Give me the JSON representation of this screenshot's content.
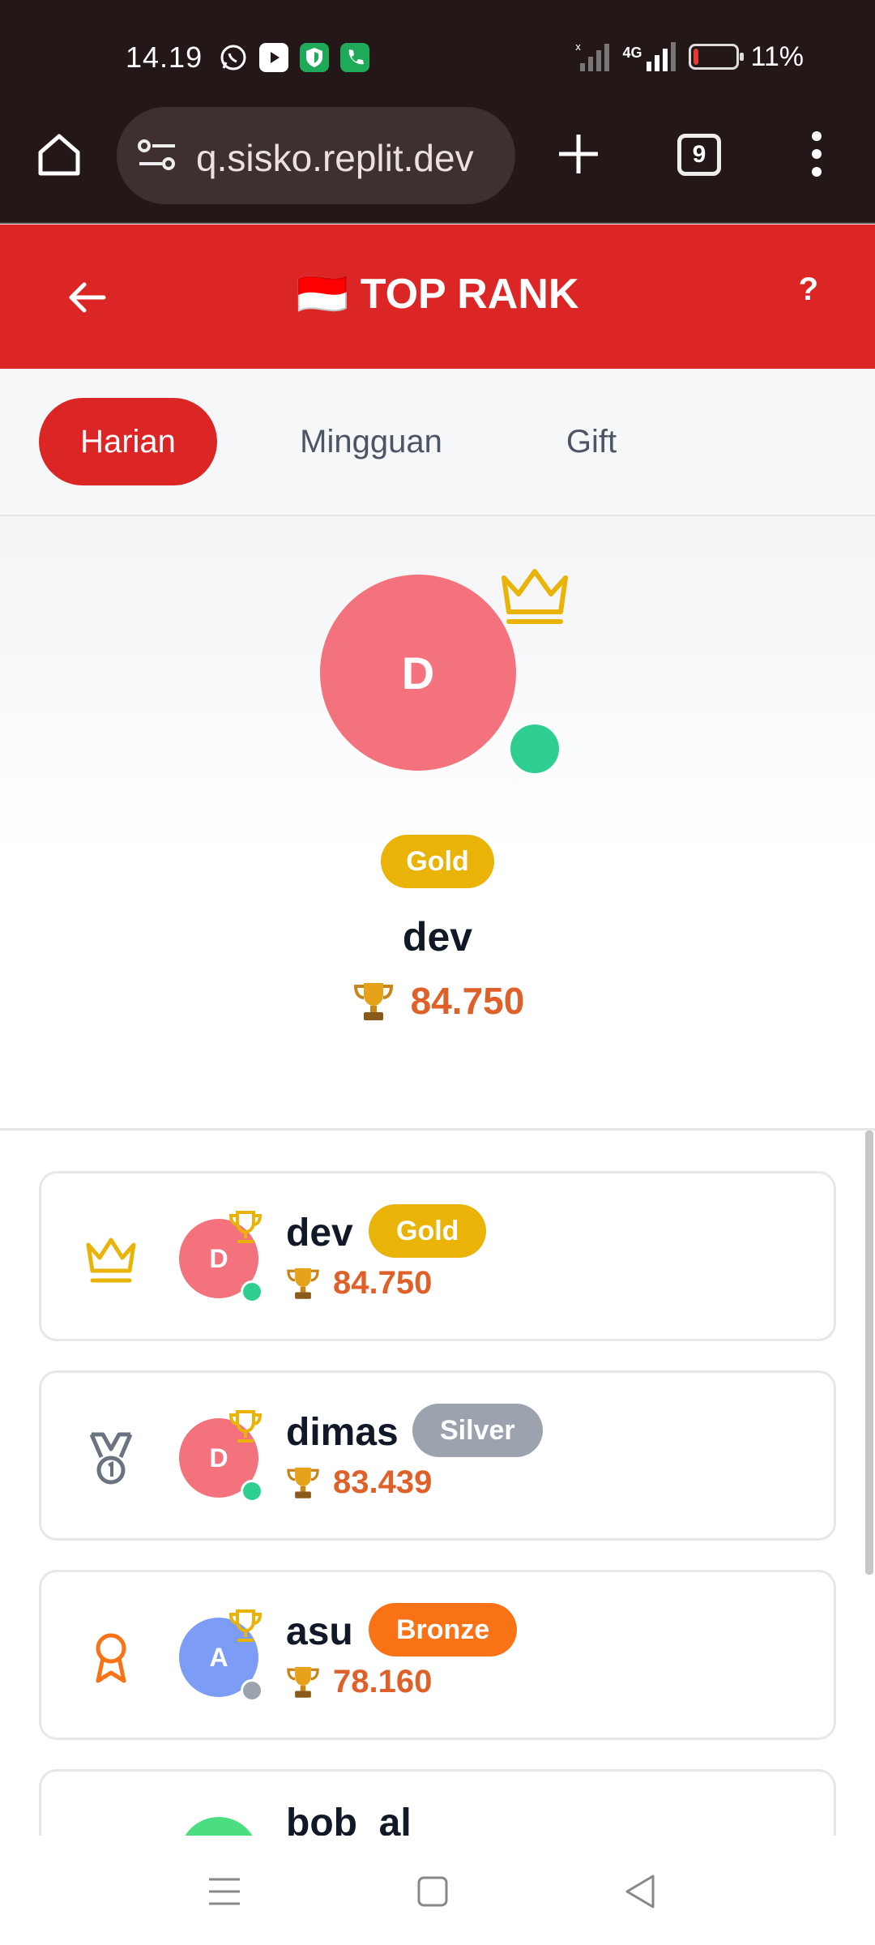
{
  "status_bar": {
    "time": "14.19",
    "apps": [
      "whatsapp-icon",
      "youtube-icon",
      "shield-app-icon",
      "phone-app-icon"
    ],
    "network": "4G",
    "battery_percent": "11%",
    "battery_level": 0.11
  },
  "browser": {
    "url": "q.sisko.replit.dev",
    "tab_count": "9"
  },
  "header": {
    "flag": "🇮🇩",
    "title": "TOP RANK",
    "help": "?"
  },
  "tabs": [
    {
      "label": "Harian",
      "active": true
    },
    {
      "label": "Mingguan",
      "active": false
    },
    {
      "label": "Gift",
      "active": false
    }
  ],
  "top_player": {
    "initial": "D",
    "tier": "Gold",
    "name": "dev",
    "score": "84.750",
    "online": true
  },
  "ranking": [
    {
      "initial": "D",
      "name": "dev",
      "tier": "Gold",
      "score": "84.750",
      "rank_icon": "crown-icon",
      "avatar_color": "#f4727d",
      "tier_color": "#eab308",
      "status_color": "#2ecf91"
    },
    {
      "initial": "D",
      "name": "dimas",
      "tier": "Silver",
      "score": "83.439",
      "rank_icon": "medal-icon",
      "avatar_color": "#f4727d",
      "tier_color": "#9ca3af",
      "status_color": "#2ecf91"
    },
    {
      "initial": "A",
      "name": "asu",
      "tier": "Bronze",
      "score": "78.160",
      "rank_icon": "ribbon-award-icon",
      "avatar_color": "#7c9cf5",
      "tier_color": "#f97316",
      "status_color": "#9ca3af"
    },
    {
      "initial": "",
      "name": "bob_al",
      "tier": "",
      "score": "",
      "rank_icon": "",
      "avatar_color": "#4ade80",
      "tier_color": "",
      "status_color": ""
    }
  ],
  "colors": {
    "primary": "#dc2626",
    "score": "#e0602a",
    "gold": "#eab308"
  }
}
